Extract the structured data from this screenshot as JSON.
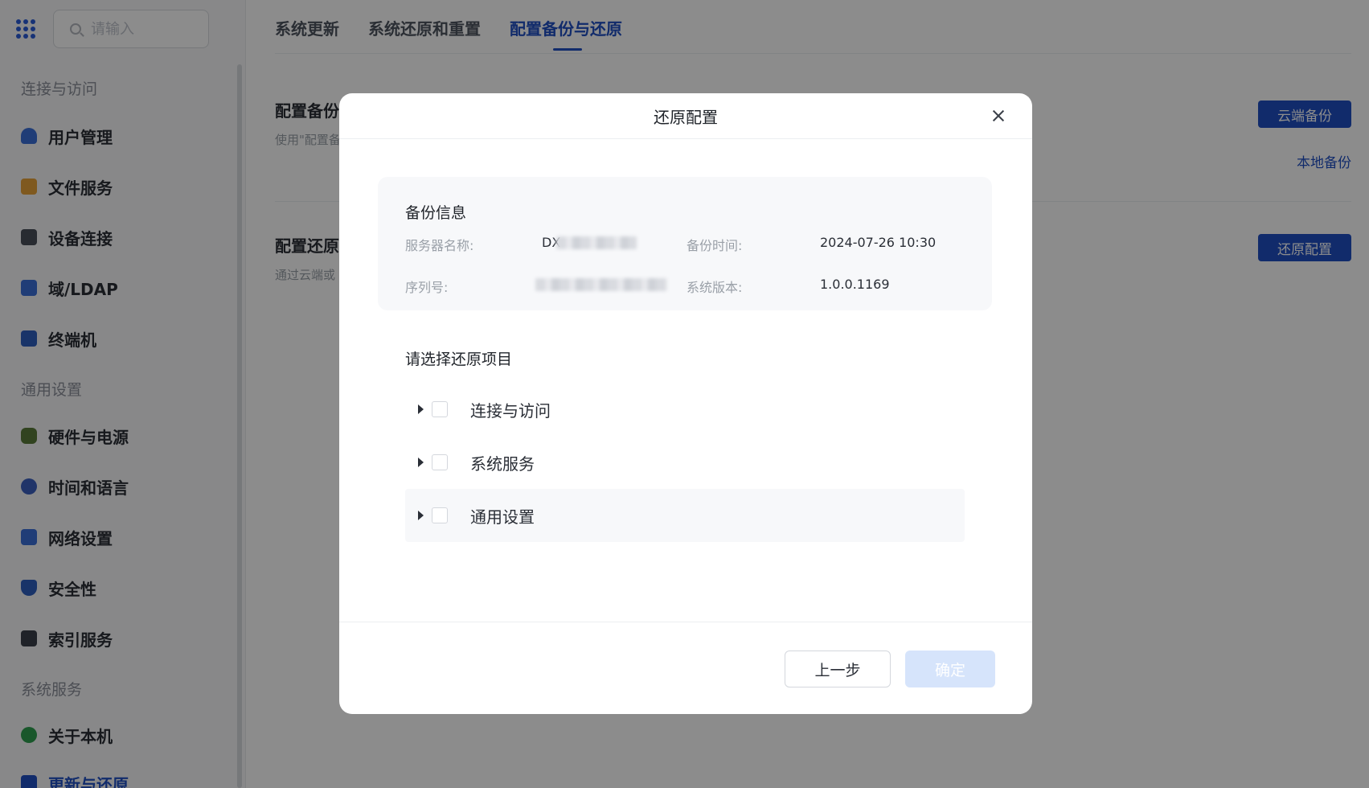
{
  "search": {
    "placeholder": "请输入"
  },
  "sidebar": {
    "sections": [
      {
        "title": "连接与访问"
      },
      {
        "title": "通用设置"
      },
      {
        "title": "系统服务"
      }
    ],
    "items": [
      {
        "label": "用户管理",
        "icon": "user-icon",
        "color": "#3b6fd9"
      },
      {
        "label": "文件服务",
        "icon": "folder-icon",
        "color": "#e8a23a"
      },
      {
        "label": "设备连接",
        "icon": "device-icon",
        "color": "#4a4f5a"
      },
      {
        "label": "域/LDAP",
        "icon": "domain-icon",
        "color": "#3b6fd9"
      },
      {
        "label": "终端机",
        "icon": "terminal-icon",
        "color": "#2f5fbf"
      },
      {
        "label": "硬件与电源",
        "icon": "battery-icon",
        "color": "#5a7a3a"
      },
      {
        "label": "时间和语言",
        "icon": "globe-icon",
        "color": "#3b5fbf"
      },
      {
        "label": "网络设置",
        "icon": "network-icon",
        "color": "#3b6fd9"
      },
      {
        "label": "安全性",
        "icon": "shield-icon",
        "color": "#2f5fbf"
      },
      {
        "label": "索引服务",
        "icon": "index-icon",
        "color": "#3a3f4a"
      },
      {
        "label": "关于本机",
        "icon": "info-icon",
        "color": "#2f9e4f"
      },
      {
        "label": "更新与还原",
        "icon": "update-icon",
        "color": "#1f4fc4"
      }
    ]
  },
  "tabs": [
    "系统更新",
    "系统还原和重置",
    "配置备份与还原"
  ],
  "main": {
    "backup": {
      "title": "配置备份",
      "desc": "使用\"配置备",
      "cloud_button": "云端备份",
      "local_link": "本地备份"
    },
    "restore": {
      "title": "配置还原",
      "desc": "通过云端或",
      "button": "还原配置"
    }
  },
  "modal": {
    "title": "还原配置",
    "info": {
      "title": "备份信息",
      "server_label": "服务器名称:",
      "server_value": "DX",
      "time_label": "备份时间:",
      "time_value": "2024-07-26 10:30",
      "serial_label": "序列号:",
      "version_label": "系统版本:",
      "version_value": "1.0.0.1169"
    },
    "choose_title": "请选择还原项目",
    "items": [
      "连接与访问",
      "系统服务",
      "通用设置"
    ],
    "prev_button": "上一步",
    "ok_button": "确定"
  }
}
